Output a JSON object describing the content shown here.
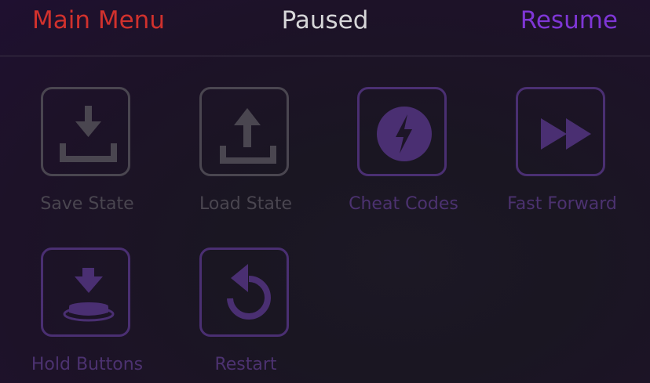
{
  "header": {
    "left_label": "Main Menu",
    "title": "Paused",
    "right_label": "Resume"
  },
  "colors": {
    "main_menu": "#d0312d",
    "title": "#d6d6d8",
    "resume": "#7f36d6",
    "inactive": "#4a4650",
    "active": "#4a2f72"
  },
  "items": [
    {
      "label": "Save State",
      "icon": "save-state-icon"
    },
    {
      "label": "Load State",
      "icon": "load-state-icon"
    },
    {
      "label": "Cheat Codes",
      "icon": "lightning-icon"
    },
    {
      "label": "Fast Forward",
      "icon": "fast-forward-icon"
    },
    {
      "label": "Hold Buttons",
      "icon": "hold-buttons-icon"
    },
    {
      "label": "Restart",
      "icon": "restart-icon"
    }
  ]
}
